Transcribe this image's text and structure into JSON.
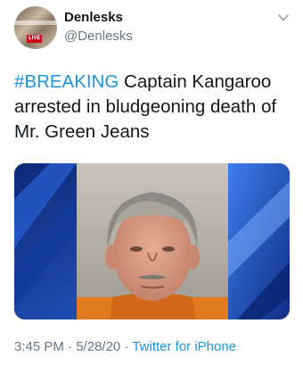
{
  "tweet": {
    "author_name": "Denlesks",
    "author_handle": "@Denlesks",
    "avatar_badge": "LIVE",
    "hashtag": "#BREAKING",
    "body": " Captain Kangaroo arrested in bludgeoning death of Mr. Green Jeans",
    "time": "3:45 PM",
    "separator_1": " · ",
    "date": "5/28/20",
    "separator_2": " · ",
    "source": "Twitter for iPhone"
  },
  "icons": {
    "more": "chevron-down-icon"
  },
  "colors": {
    "link": "#1b95e0",
    "secondary_text": "#657786",
    "primary_text": "#14171a",
    "media_background": "#1c3c8c",
    "mugshot_shirt": "#e07a1e"
  }
}
